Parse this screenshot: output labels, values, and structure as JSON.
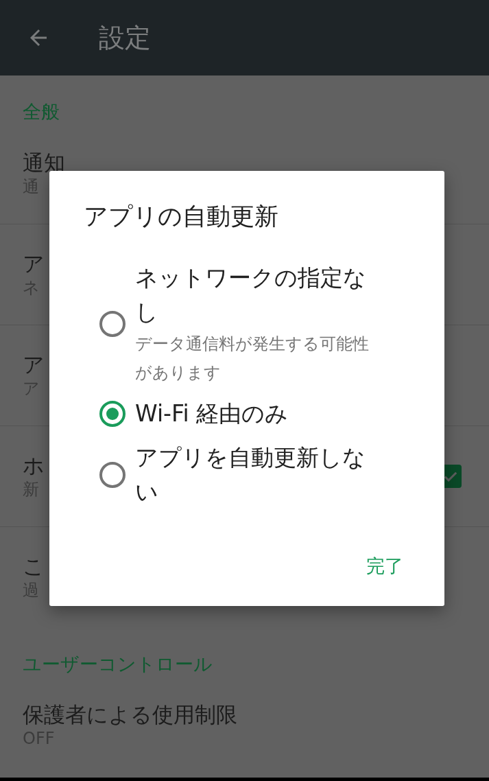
{
  "app_bar": {
    "title": "設定"
  },
  "sections": [
    {
      "header": "全般",
      "items": [
        {
          "title": "通知",
          "subtitle": "通"
        },
        {
          "title": "ア",
          "subtitle": "ネ"
        },
        {
          "title": "ア",
          "subtitle": "ア"
        },
        {
          "title": "ホ",
          "subtitle": "新",
          "checked": true
        },
        {
          "title": "こ",
          "subtitle": "過"
        }
      ]
    },
    {
      "header": "ユーザーコントロール",
      "items": [
        {
          "title": "保護者による使用制限",
          "subtitle": "OFF"
        }
      ]
    }
  ],
  "dialog": {
    "title": "アプリの自動更新",
    "options": [
      {
        "label": "ネットワークの指定なし",
        "description": "データ通信料が発生する可能性があります",
        "selected": false
      },
      {
        "label": "Wi-Fi 経由のみ",
        "selected": true
      },
      {
        "label": "アプリを自動更新しない",
        "selected": false
      }
    ],
    "button": "完了"
  }
}
